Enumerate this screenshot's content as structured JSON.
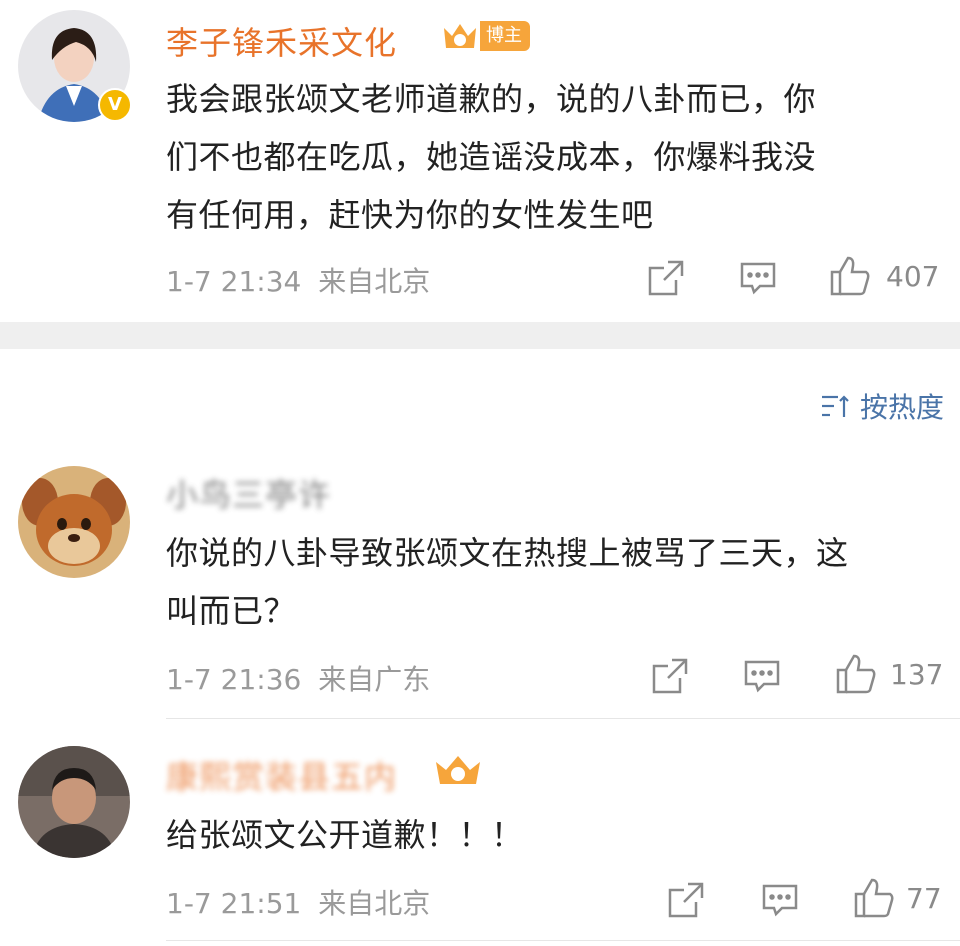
{
  "comments": [
    {
      "author": "李子锋禾采文化",
      "badge_label": "博主",
      "text_lines": [
        "我会跟张颂文老师道歉的，说的八卦而已，你",
        "们不也都在吃瓜，她造谣没成本，你爆料我没",
        "有任何用，赶快为你的女性发生吧"
      ],
      "date": "1-7 21:34",
      "location": "来自北京",
      "likes": "407"
    },
    {
      "author": "小鸟三亭许",
      "text_lines": [
        "你说的八卦导致张颂文在热搜上被骂了三天，这",
        "叫而已？"
      ],
      "date": "1-7 21:36",
      "location": "来自广东",
      "likes": "137"
    },
    {
      "author": "康熙赏装县五内",
      "text_lines": [
        "给张颂文公开道歉！！！"
      ],
      "date": "1-7 21:51",
      "location": "来自北京",
      "likes": "77"
    }
  ],
  "sort_label": "按热度",
  "colors": {
    "name": "#e8732a",
    "link": "#4a74a8",
    "meta": "#9a9a9a",
    "verified": "#f5b800"
  }
}
